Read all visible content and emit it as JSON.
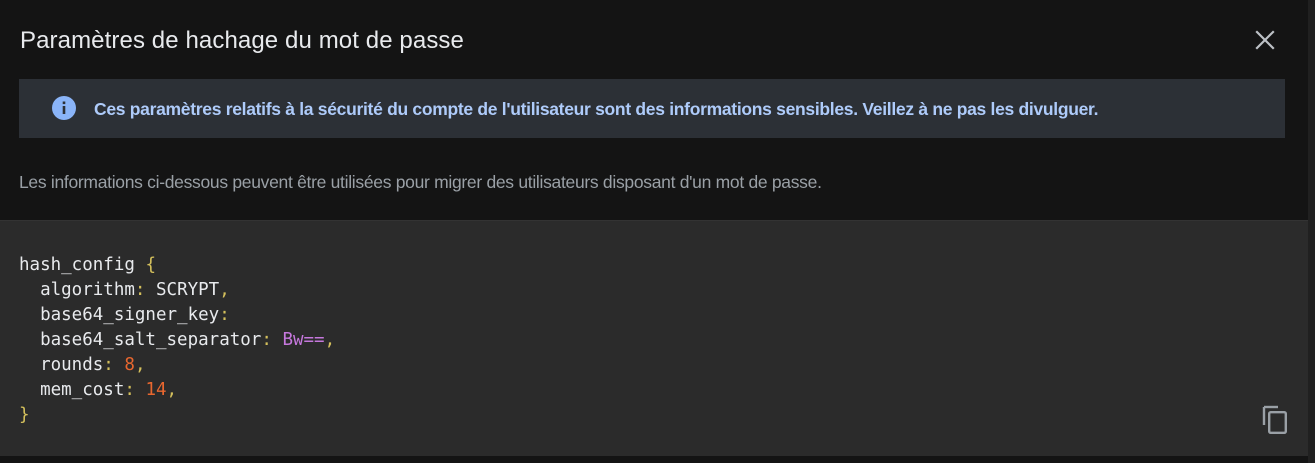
{
  "dialog": {
    "title": "Paramètres de hachage du mot de passe",
    "close_icon": "close-icon"
  },
  "banner": {
    "icon": "info-icon",
    "text": "Ces paramètres relatifs à la sécurité du compte de l'utilisateur sont des informations sensibles. Veillez à ne pas les divulguer."
  },
  "description": "Les informations ci-dessous peuvent être utilisées pour migrer des utilisateurs disposant d'un mot de passe.",
  "code": {
    "root_key": "hash_config",
    "open_brace": "{",
    "close_brace": "}",
    "fields": [
      {
        "key": "algorithm",
        "value": "SCRYPT",
        "type": "val"
      },
      {
        "key": "base64_signer_key",
        "value": "",
        "type": "val"
      },
      {
        "key": "base64_salt_separator",
        "value": "Bw==",
        "type": "str"
      },
      {
        "key": "rounds",
        "value": "8",
        "type": "num"
      },
      {
        "key": "mem_cost",
        "value": "14",
        "type": "num"
      }
    ],
    "copy_icon": "copy-icon"
  },
  "colors": {
    "background": "#141414",
    "banner_bg": "#2c3036",
    "banner_text": "#aecbfa",
    "info_icon": "#8ab4f8",
    "code_bg": "#2b2b2b",
    "punctuation": "#d4c05c",
    "string": "#c678dd",
    "number": "#e8672f"
  }
}
